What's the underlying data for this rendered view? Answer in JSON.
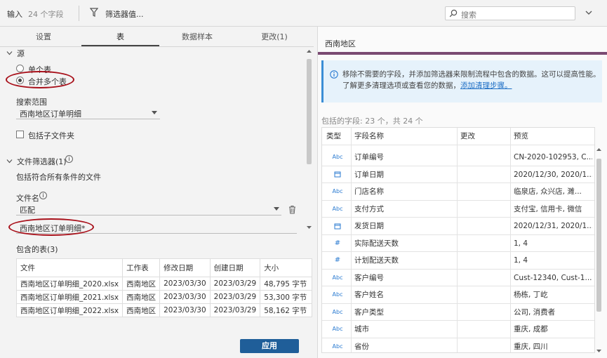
{
  "topbar": {
    "input_label": "输入",
    "field_count": "24 个字段",
    "filter_label": "筛选器值...",
    "search_placeholder": "搜索"
  },
  "tabs": [
    "设置",
    "表",
    "数据样本",
    "更改(1)"
  ],
  "source": {
    "heading": "源",
    "single_table": "单个表",
    "multi_table": "合并多个表",
    "search_scope_label": "搜索范围",
    "search_scope_value": "西南地区订单明细",
    "include_subfolders": "包括子文件夹"
  },
  "file_filter": {
    "heading": "文件筛选器(1)",
    "description": "包括符合所有条件的文件",
    "filename_label": "文件名",
    "match_value": "匹配",
    "pattern_value": "西南地区订单明细*"
  },
  "included_tables": {
    "heading": "包含的表(3)",
    "columns": [
      "文件",
      "工作表",
      "修改日期",
      "创建日期",
      "大小"
    ],
    "rows": [
      [
        "西南地区订单明细_2020.xlsx",
        "西南地区",
        "2023/03/30",
        "2023/03/29",
        "48,795 字节"
      ],
      [
        "西南地区订单明细_2021.xlsx",
        "西南地区",
        "2023/03/30",
        "2023/03/29",
        "53,300 字节"
      ],
      [
        "西南地区订单明细_2022.xlsx",
        "西南地区",
        "2023/03/30",
        "2023/03/29",
        "58,162 字节"
      ]
    ]
  },
  "apply_label": "应用",
  "right": {
    "title": "西南地区",
    "info_text": "移除不需要的字段，并添加筛选器来限制流程中包含的数据。这可以提高性能。了解更多清理选项或查看您的数据，",
    "info_link": "添加清理步骤。",
    "fields_summary": "包括的字段: 23 个，共 24 个",
    "columns": [
      "类型",
      "字段名称",
      "更改",
      "预览"
    ],
    "fields": [
      {
        "type": "Abc",
        "name": "订单编号",
        "preview": "CN-2020-102953, C..."
      },
      {
        "type": "date",
        "name": "订单日期",
        "preview": "2020/12/30, 2020/1..."
      },
      {
        "type": "Abc",
        "name": "门店名称",
        "preview": "临泉店, 众兴店, 濉..."
      },
      {
        "type": "Abc",
        "name": "支付方式",
        "preview": "支付宝, 信用卡, 微信"
      },
      {
        "type": "date",
        "name": "发货日期",
        "preview": "2020/12/31, 2020/1..."
      },
      {
        "type": "#",
        "name": "实际配送天数",
        "preview": "1, 4"
      },
      {
        "type": "#",
        "name": "计划配送天数",
        "preview": "1, 4"
      },
      {
        "type": "Abc",
        "name": "客户编号",
        "preview": "Cust-12340, Cust-1..."
      },
      {
        "type": "Abc",
        "name": "客户姓名",
        "preview": "杨栋, 丁屹"
      },
      {
        "type": "Abc",
        "name": "客户类型",
        "preview": "公司, 消费者"
      },
      {
        "type": "Abc",
        "name": "城市",
        "preview": "重庆, 成都"
      },
      {
        "type": "Abc",
        "name": "省份",
        "preview": "重庆, 四川"
      }
    ]
  },
  "colors": {
    "accent_bar": "#7a4a72",
    "highlight_ellipse": "#a8101a",
    "apply_button": "#1f5e99",
    "type_icon": "#2b7bd1"
  }
}
